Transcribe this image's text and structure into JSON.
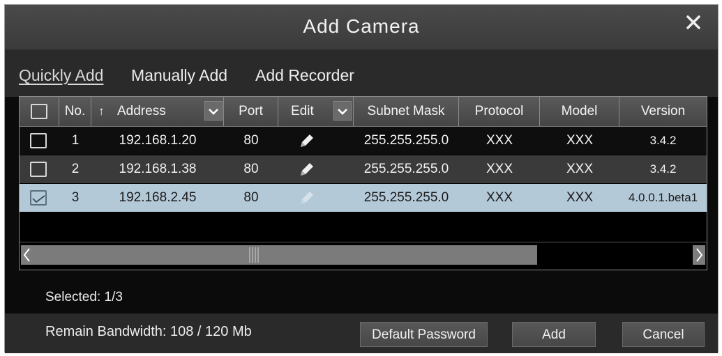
{
  "dialog": {
    "title": "Add Camera"
  },
  "tabs": [
    {
      "label": "Quickly Add",
      "active": true
    },
    {
      "label": "Manually Add",
      "active": false
    },
    {
      "label": "Add Recorder",
      "active": false
    }
  ],
  "table": {
    "headers": {
      "no": "No.",
      "address": "Address",
      "port": "Port",
      "edit": "Edit",
      "subnet": "Subnet Mask",
      "protocol": "Protocol",
      "model": "Model",
      "version": "Version"
    },
    "sort_indicator": "↑",
    "rows": [
      {
        "checked": false,
        "no": "1",
        "address": "192.168.1.20",
        "port": "80",
        "subnet": "255.255.255.0",
        "protocol": "XXX",
        "model": "XXX",
        "version": "3.4.2"
      },
      {
        "checked": false,
        "no": "2",
        "address": "192.168.1.38",
        "port": "80",
        "subnet": "255.255.255.0",
        "protocol": "XXX",
        "model": "XXX",
        "version": "3.4.2"
      },
      {
        "checked": true,
        "no": "3",
        "address": "192.168.2.45",
        "port": "80",
        "subnet": "255.255.255.0",
        "protocol": "XXX",
        "model": "XXX",
        "version": "4.0.0.1.beta1"
      }
    ]
  },
  "scrollbar": {
    "position_fraction": 0.0,
    "visible_fraction": 0.76
  },
  "status": {
    "selected": "Selected: 1/3"
  },
  "footer": {
    "bandwidth": "Remain Bandwidth: 108 / 120 Mb",
    "default_password_label": "Default Password",
    "add_label": "Add",
    "cancel_label": "Cancel"
  },
  "colors": {
    "selected_row": "#b4c9d8",
    "title_bar": "#434343",
    "background": "#0b0b0b"
  },
  "icons": [
    "close-icon",
    "sort-arrow-icon",
    "dropdown-chevron-icon",
    "pencil-icon",
    "checkmark-icon",
    "scroll-left-icon",
    "scroll-right-icon"
  ]
}
